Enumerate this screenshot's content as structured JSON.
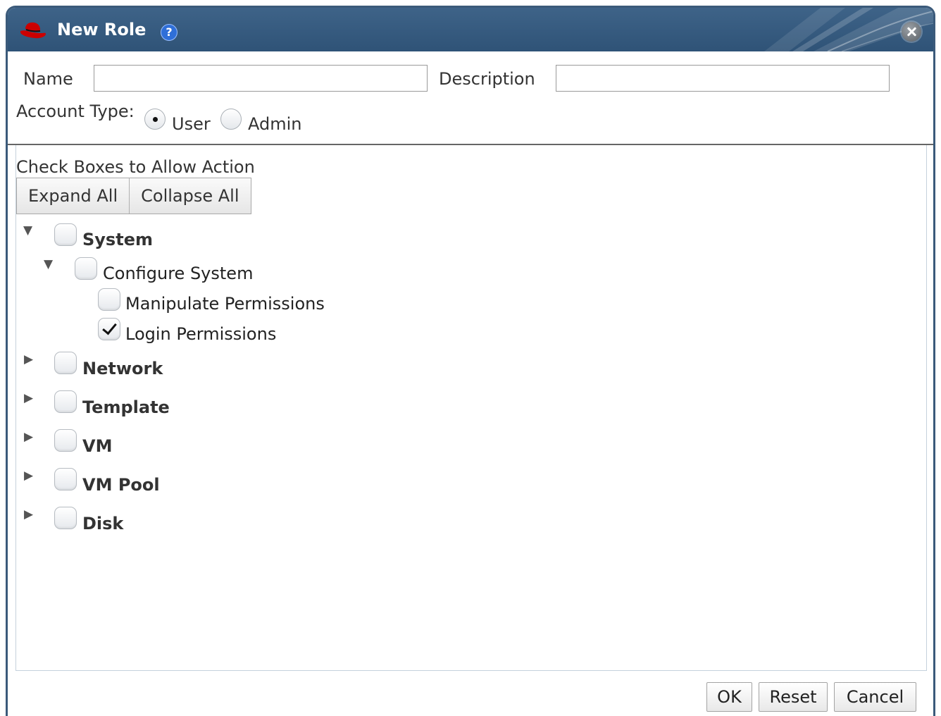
{
  "dialog": {
    "title": "New Role",
    "help_icon": "help-icon",
    "close_icon": "close-icon",
    "help_glyph": "?"
  },
  "form": {
    "name_label": "Name",
    "name_value": "",
    "description_label": "Description",
    "description_value": "",
    "account_type_label": "Account Type:",
    "account_types": [
      {
        "label": "User",
        "selected": true
      },
      {
        "label": "Admin",
        "selected": false
      }
    ]
  },
  "permissions": {
    "heading": "Check Boxes to Allow Action",
    "expand_all": "Expand All",
    "collapse_all": "Collapse All",
    "tree": [
      {
        "label": "System",
        "expanded": true,
        "checked": false,
        "children": [
          {
            "label": "Configure System",
            "expanded": true,
            "checked": false,
            "children": [
              {
                "label": "Manipulate Permissions",
                "checked": false
              },
              {
                "label": "Login Permissions",
                "checked": true
              }
            ]
          }
        ]
      },
      {
        "label": "Network",
        "expanded": false,
        "checked": false
      },
      {
        "label": "Template",
        "expanded": false,
        "checked": false
      },
      {
        "label": "VM",
        "expanded": false,
        "checked": false
      },
      {
        "label": "VM Pool",
        "expanded": false,
        "checked": false
      },
      {
        "label": "Disk",
        "expanded": false,
        "checked": false
      }
    ]
  },
  "footer": {
    "ok": "OK",
    "reset": "Reset",
    "cancel": "Cancel"
  },
  "glyphs": {
    "expanded": "▼",
    "collapsed": "▶"
  },
  "colors": {
    "titlebar": "#2f5377",
    "border": "#3b5a7a",
    "help": "#2f6fd8",
    "logo": "#cc0000"
  }
}
